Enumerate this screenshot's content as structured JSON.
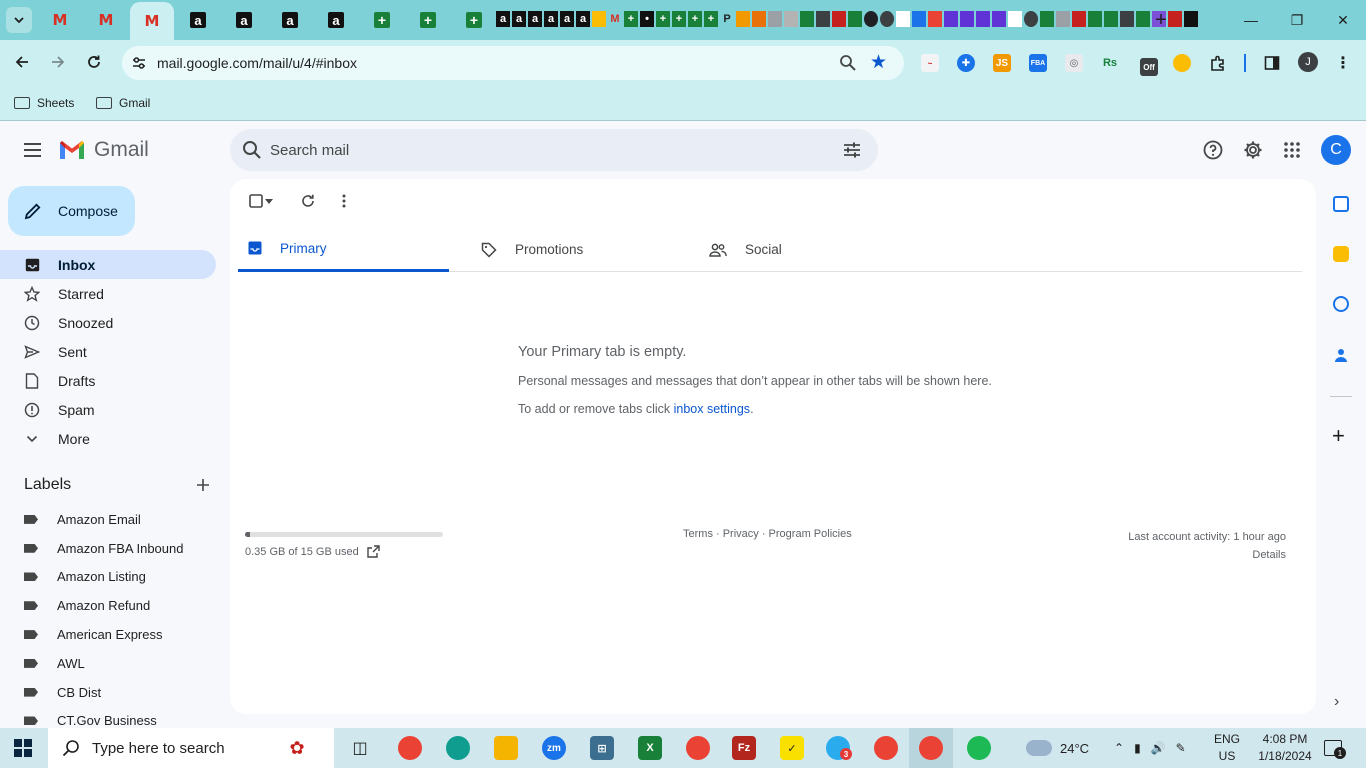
{
  "browser": {
    "url": "mail.google.com/mail/u/4/#inbox",
    "bookmarks": [
      "Sheets",
      "Gmail"
    ],
    "profile_initial": "J",
    "mini_tabs": [
      "a",
      "a",
      "a",
      "a",
      "a",
      "a"
    ]
  },
  "gmail": {
    "product_name": "Gmail",
    "search_placeholder": "Search mail",
    "avatar_initial": "C",
    "compose_label": "Compose",
    "nav": [
      {
        "label": "Inbox"
      },
      {
        "label": "Starred"
      },
      {
        "label": "Snoozed"
      },
      {
        "label": "Sent"
      },
      {
        "label": "Drafts"
      },
      {
        "label": "Spam"
      },
      {
        "label": "More"
      }
    ],
    "labels_heading": "Labels",
    "labels": [
      {
        "label": "Amazon Email"
      },
      {
        "label": "Amazon FBA Inbound"
      },
      {
        "label": "Amazon Listing"
      },
      {
        "label": "Amazon Refund"
      },
      {
        "label": "American Express"
      },
      {
        "label": "AWL"
      },
      {
        "label": "CB Dist"
      },
      {
        "label": "CT.Gov Business"
      }
    ],
    "tabs": [
      {
        "label": "Primary"
      },
      {
        "label": "Promotions"
      },
      {
        "label": "Social"
      }
    ],
    "empty": {
      "title": "Your Primary tab is empty.",
      "subtitle": "Personal messages and messages that don’t appear in other tabs will be shown here.",
      "settings_prefix": "To add or remove tabs click ",
      "settings_link": "inbox settings",
      "settings_suffix": "."
    },
    "footer": {
      "storage_text": "0.35 GB of 15 GB used",
      "storage_fraction": 0.023,
      "links": "Terms · Privacy · Program Policies",
      "activity": "Last account activity: 1 hour ago",
      "details": "Details"
    }
  },
  "taskbar": {
    "search_placeholder": "Type here to search",
    "temperature": "24°C",
    "language": "ENG",
    "region": "US",
    "time": "4:08 PM",
    "date": "1/18/2024",
    "notification_count": "1",
    "telegram_badge": "3"
  }
}
